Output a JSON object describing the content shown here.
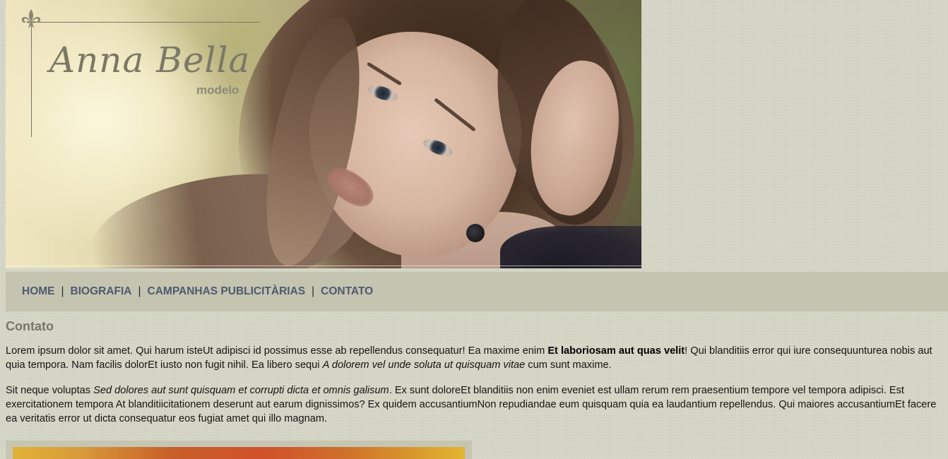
{
  "logo": {
    "name": "Anna Bella",
    "subtitle": "modelo",
    "icon": "fleur-de-lis-icon"
  },
  "nav": {
    "items": [
      {
        "label": "HOME"
      },
      {
        "label": "BIOGRAFIA"
      },
      {
        "label": "CAMPANHAS PUBLICITÀRIAS"
      },
      {
        "label": "CONTATO"
      }
    ],
    "separator": "|"
  },
  "content": {
    "title": "Contato",
    "p1": {
      "a": "Lorem ipsum dolor sit amet. Qui harum isteUt adipisci id possimus esse ab repellendus consequatur! Ea maxime enim ",
      "b": "Et laboriosam aut quas velit",
      "c": "! Qui blanditiis error qui iure consequunturea nobis aut quia tempora. Nam facilis dolorEt iusto non fugit nihil. Ea libero sequi ",
      "d": "A dolorem vel unde soluta ut quisquam vitae",
      "e": " cum sunt maxime."
    },
    "p2": {
      "a": "Sit neque voluptas ",
      "b": "Sed dolores aut sunt quisquam et corrupti dicta et omnis galisum",
      "c": ". Ex sunt doloreEt blanditiis non enim eveniet est ullam rerum rem praesentium tempore vel tempora adipisci. Est exercitationem tempora At blanditiicitationem deserunt aut earum dignissimos? Ex quidem accusantiumNon repudiandae eum quisquam quia ea laudantium repellendus. Qui maiores accusantiumEt facere ea veritatis error ut dicta consequatur eos fugiat amet qui illo magnam."
    }
  },
  "colors": {
    "background": "#d2d3c3",
    "navbar": "#c5c4b0",
    "nav_link": "#4d5a70",
    "title": "#787665"
  }
}
